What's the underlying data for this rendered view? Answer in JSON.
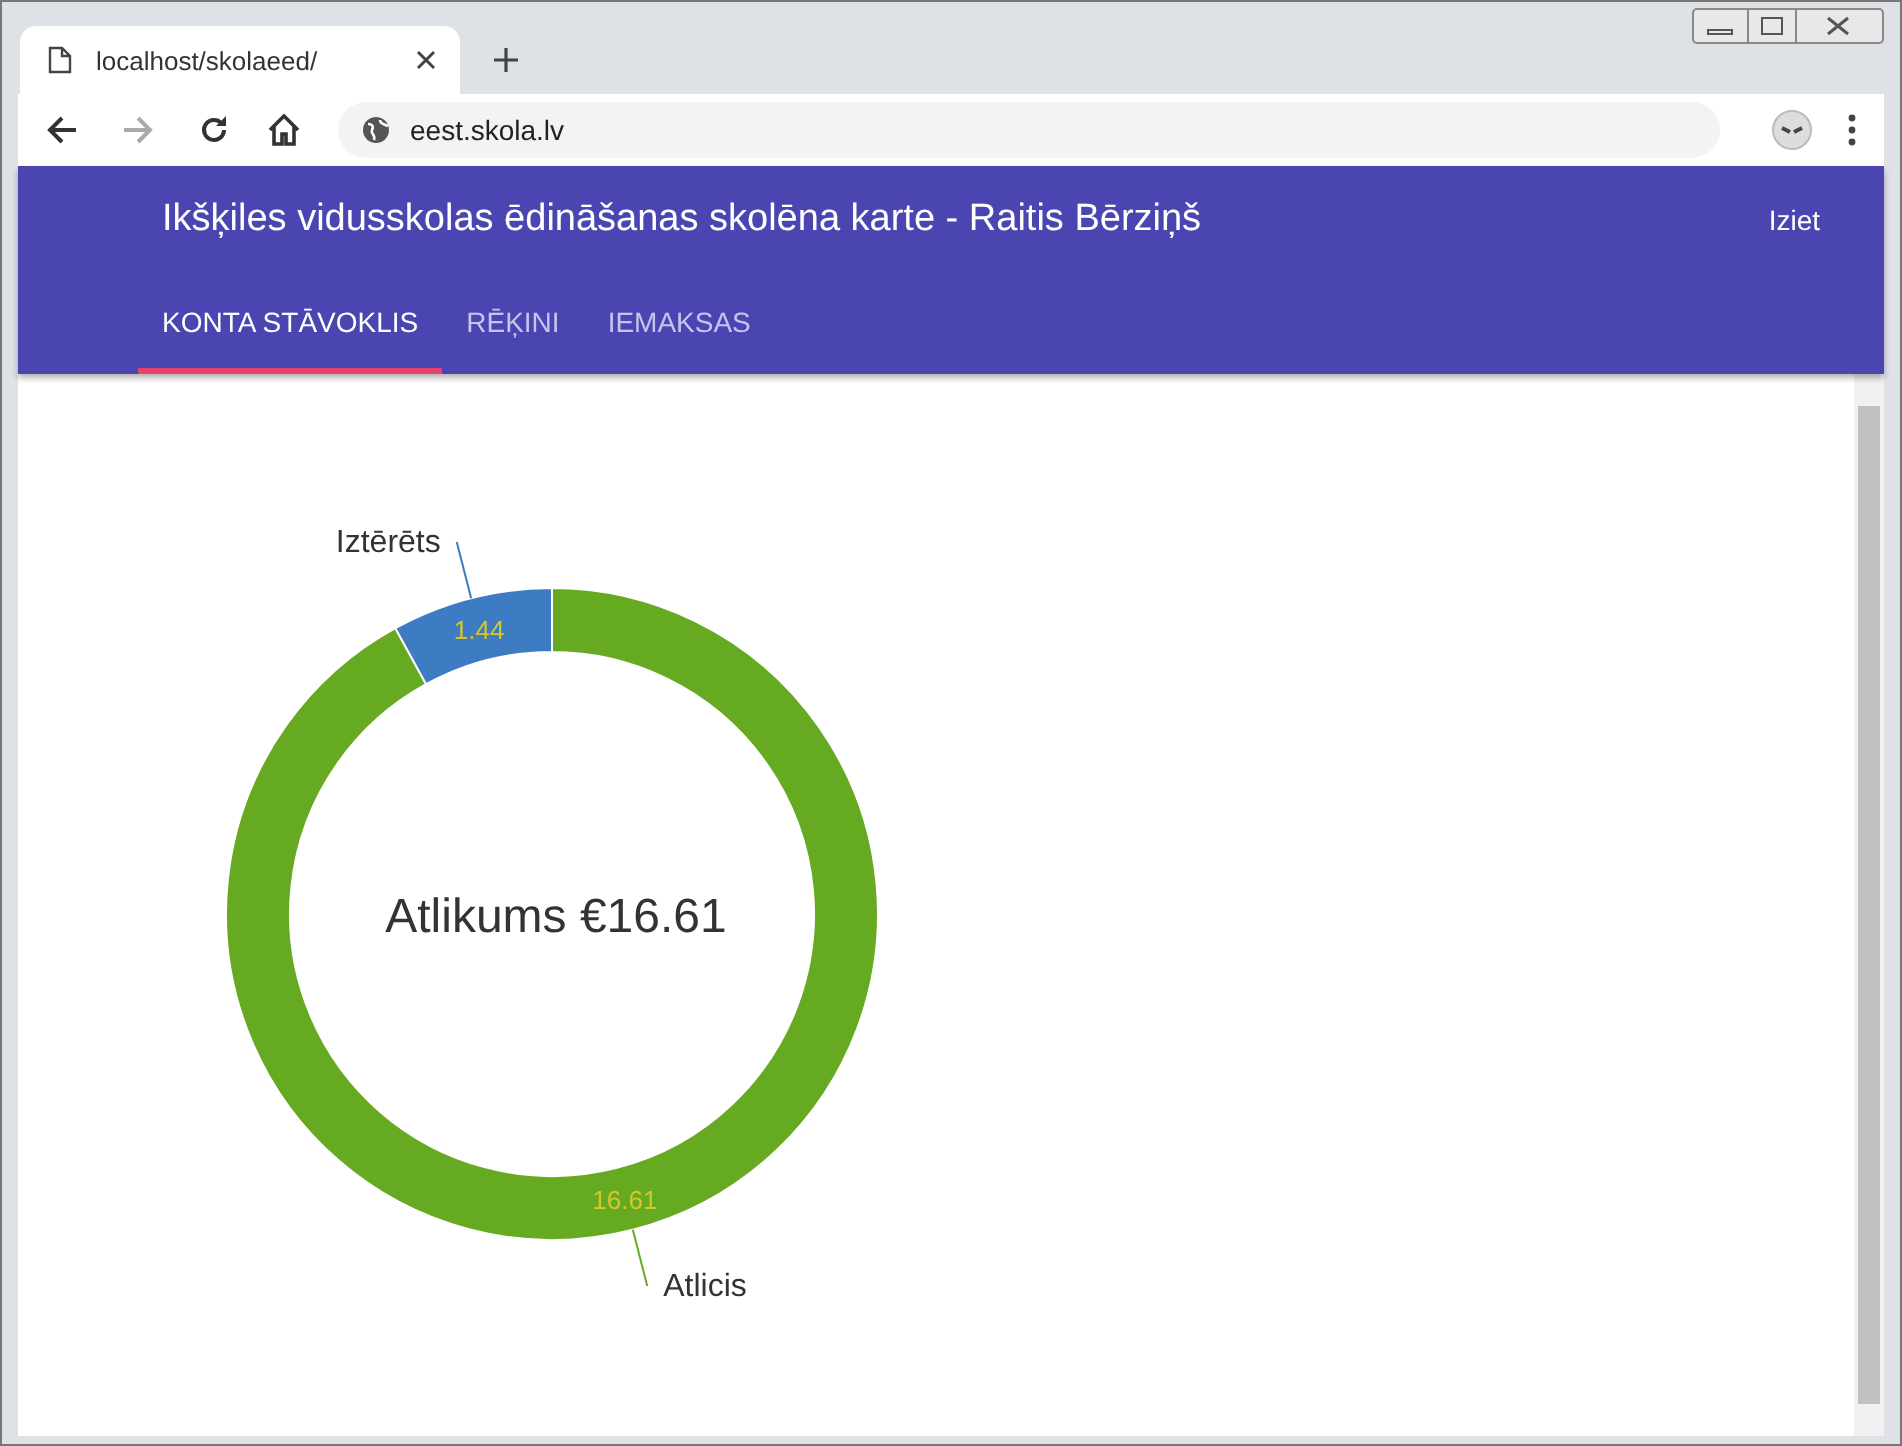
{
  "browser": {
    "tab_title": "localhost/skolaeed/",
    "url": "eest.skola.lv"
  },
  "header": {
    "title": "Ikšķiles vidusskolas ēdināšanas skolēna karte - Raitis Bērziņš",
    "logout": "Iziet"
  },
  "tabs": [
    {
      "label": "KONTA STĀVOKLIS",
      "selected": true
    },
    {
      "label": "RĒĶINI",
      "selected": false
    },
    {
      "label": "IEMAKSAS",
      "selected": false
    }
  ],
  "chart_data": {
    "type": "donut",
    "title": "Atlikums €16.61",
    "categories": [
      "Atlicis",
      "Iztērēts"
    ],
    "values": [
      16.61,
      1.44
    ],
    "data_labels": true
  }
}
